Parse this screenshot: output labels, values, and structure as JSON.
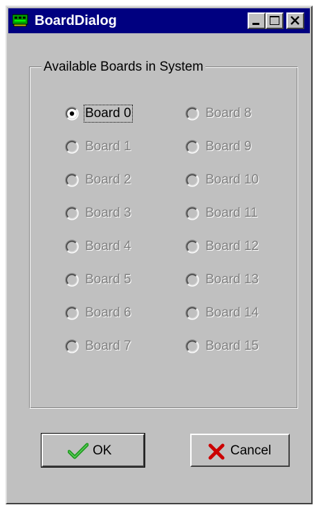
{
  "window": {
    "title": "BoardDialog",
    "icon": "board-card-icon",
    "controls": [
      "minimize",
      "maximize",
      "close"
    ]
  },
  "group": {
    "label": "Available Boards in System"
  },
  "boards": [
    {
      "label": "Board 0",
      "selected": true,
      "enabled": true
    },
    {
      "label": "Board 1",
      "selected": false,
      "enabled": false
    },
    {
      "label": "Board 2",
      "selected": false,
      "enabled": false
    },
    {
      "label": "Board 3",
      "selected": false,
      "enabled": false
    },
    {
      "label": "Board 4",
      "selected": false,
      "enabled": false
    },
    {
      "label": "Board 5",
      "selected": false,
      "enabled": false
    },
    {
      "label": "Board 6",
      "selected": false,
      "enabled": false
    },
    {
      "label": "Board 7",
      "selected": false,
      "enabled": false
    },
    {
      "label": "Board 8",
      "selected": false,
      "enabled": false
    },
    {
      "label": "Board 9",
      "selected": false,
      "enabled": false
    },
    {
      "label": "Board 10",
      "selected": false,
      "enabled": false
    },
    {
      "label": "Board 11",
      "selected": false,
      "enabled": false
    },
    {
      "label": "Board 12",
      "selected": false,
      "enabled": false
    },
    {
      "label": "Board 13",
      "selected": false,
      "enabled": false
    },
    {
      "label": "Board 14",
      "selected": false,
      "enabled": false
    },
    {
      "label": "Board 15",
      "selected": false,
      "enabled": false
    }
  ],
  "buttons": {
    "ok_label": "OK",
    "ok_icon": "checkmark-icon",
    "cancel_label": "Cancel",
    "cancel_icon": "x-mark-icon"
  },
  "colors": {
    "titlebar": "#000080",
    "face": "#c0c0c0",
    "disabled_text": "#808080",
    "ok_check": "#1e9a1e",
    "cancel_x": "#cc0000"
  }
}
